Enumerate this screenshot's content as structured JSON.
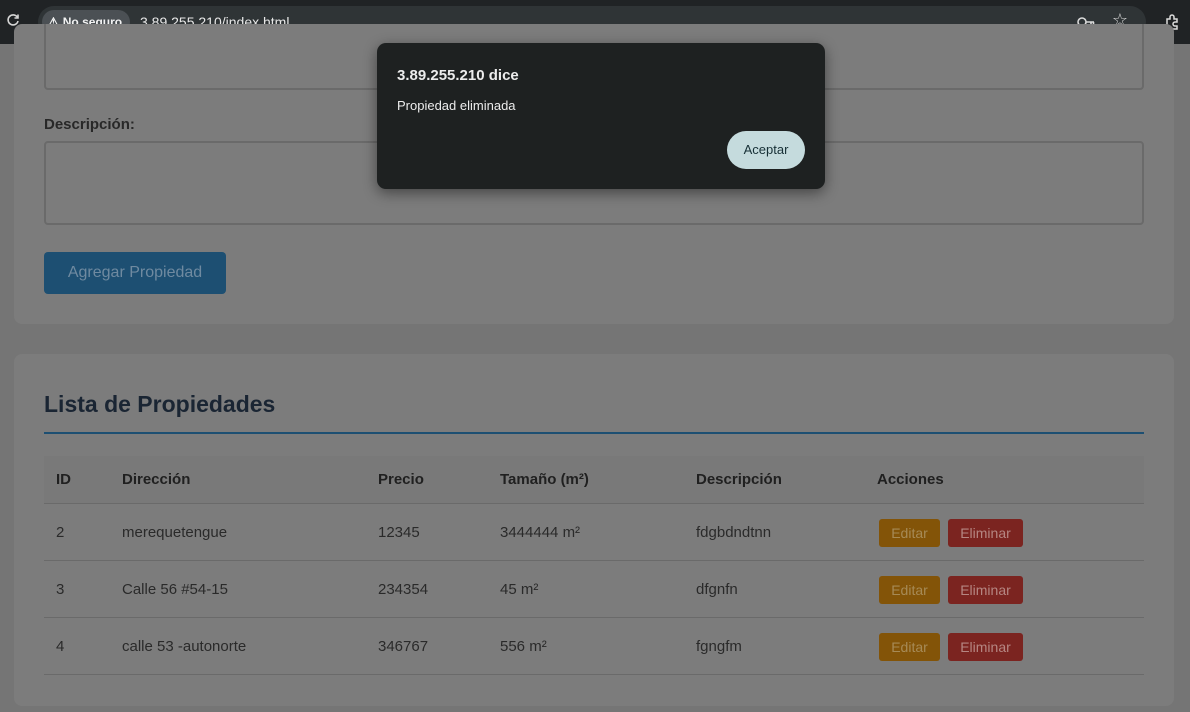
{
  "browser": {
    "security_label": "No seguro",
    "url": "3.89.255.210/index.html"
  },
  "form": {
    "description_label": "Descripción:",
    "submit_label": "Agregar Propiedad"
  },
  "list": {
    "title": "Lista de Propiedades",
    "columns": [
      "ID",
      "Dirección",
      "Precio",
      "Tamaño (m²)",
      "Descripción",
      "Acciones"
    ],
    "rows": [
      {
        "id": "2",
        "direccion": "merequetengue",
        "precio": "12345",
        "tamano": "3444444 m²",
        "descripcion": "fdgbdndtnn",
        "edit_label": "Editar",
        "delete_label": "Eliminar"
      },
      {
        "id": "3",
        "direccion": "Calle 56 #54-15",
        "precio": "234354",
        "tamano": "45 m²",
        "descripcion": "dfgnfn",
        "edit_label": "Editar",
        "delete_label": "Eliminar"
      },
      {
        "id": "4",
        "direccion": "calle 53 -autonorte",
        "precio": "346767",
        "tamano": "556 m²",
        "descripcion": "fgngfm",
        "edit_label": "Editar",
        "delete_label": "Eliminar"
      }
    ]
  },
  "dialog": {
    "title": "3.89.255.210 dice",
    "message": "Propiedad eliminada",
    "ok_label": "Aceptar"
  },
  "icons": {
    "reload": "reload-icon",
    "warning": "warning-icon",
    "key": "key-icon",
    "star": "star-icon",
    "extensions": "extensions-icon"
  },
  "colors": {
    "primary": "#2980b9",
    "edit": "#f39c12",
    "delete": "#e74c3c",
    "dialog_bg": "#1e2121",
    "dialog_button": "#c5dbdd"
  }
}
